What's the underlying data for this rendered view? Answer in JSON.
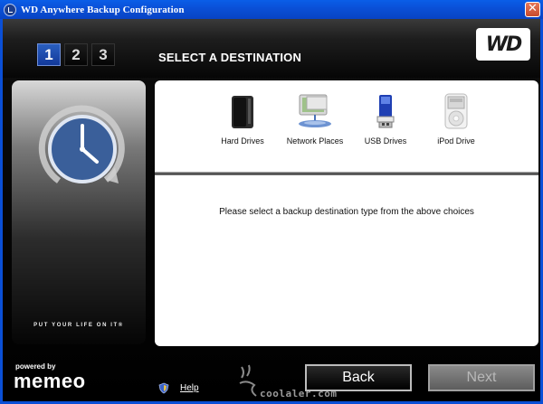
{
  "window": {
    "title": "WD Anywhere Backup Configuration",
    "close_glyph": "✕"
  },
  "steps": [
    "1",
    "2",
    "3"
  ],
  "active_step": "1",
  "header": {
    "title": "SELECT A DESTINATION",
    "logo_text": "WD"
  },
  "left_panel": {
    "tagline": "PUT YOUR LIFE ON IT®"
  },
  "destinations": [
    {
      "label": "Hard Drives",
      "icon": "hard-drive-icon"
    },
    {
      "label": "Network Places",
      "icon": "network-places-icon"
    },
    {
      "label": "USB Drives",
      "icon": "usb-drive-icon"
    },
    {
      "label": "iPod Drive",
      "icon": "ipod-icon"
    }
  ],
  "instruction": "Please select a backup destination type from the above choices",
  "footer": {
    "powered_by": "powered by",
    "brand": "memeo",
    "help_label": "Help",
    "back_label": "Back",
    "next_label": "Next",
    "watermark": "coolaler.com"
  },
  "colors": {
    "accent_blue": "#12399a",
    "title_bar": "#0a4fd6",
    "clock_face": "#3a5f9a"
  }
}
